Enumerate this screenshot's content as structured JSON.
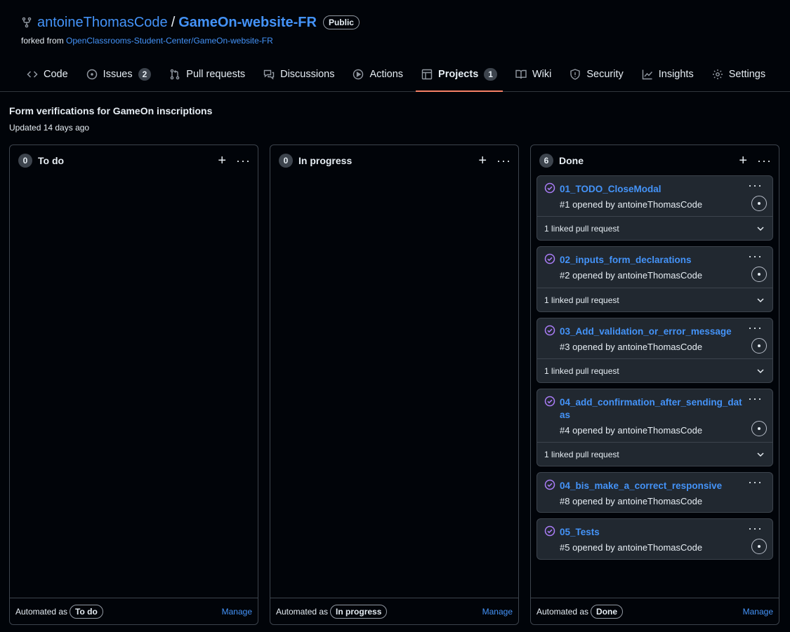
{
  "repo": {
    "owner": "antoineThomasCode",
    "slash": "/",
    "name": "GameOn-website-FR",
    "visibility": "Public",
    "forked_prefix": "forked from",
    "forked_from": "OpenClassrooms-Student-Center/GameOn-website-FR"
  },
  "tabs": [
    {
      "label": "Code",
      "icon": "code-icon"
    },
    {
      "label": "Issues",
      "icon": "issue-icon",
      "count": "2"
    },
    {
      "label": "Pull requests",
      "icon": "pull-request-icon"
    },
    {
      "label": "Discussions",
      "icon": "discussions-icon"
    },
    {
      "label": "Actions",
      "icon": "play-icon"
    },
    {
      "label": "Projects",
      "icon": "table-icon",
      "count": "1",
      "active": true
    },
    {
      "label": "Wiki",
      "icon": "book-icon"
    },
    {
      "label": "Security",
      "icon": "shield-icon"
    },
    {
      "label": "Insights",
      "icon": "graph-icon"
    },
    {
      "label": "Settings",
      "icon": "gear-icon"
    }
  ],
  "project": {
    "title": "Form verifications for GameOn inscriptions",
    "updated": "Updated 14 days ago"
  },
  "columns": [
    {
      "count": "0",
      "name": "To do",
      "automated_prefix": "Automated as",
      "automated_value": "To do",
      "manage": "Manage"
    },
    {
      "count": "0",
      "name": "In progress",
      "automated_prefix": "Automated as",
      "automated_value": "In progress",
      "manage": "Manage"
    },
    {
      "count": "6",
      "name": "Done",
      "automated_prefix": "Automated as",
      "automated_value": "Done",
      "manage": "Manage"
    }
  ],
  "cards": [
    {
      "title": "01_TODO_CloseModal",
      "sub": "#1 opened by antoineThomasCode",
      "linked": "1 linked pull request"
    },
    {
      "title": "02_inputs_form_declarations",
      "sub": "#2 opened by antoineThomasCode",
      "linked": "1 linked pull request"
    },
    {
      "title": "03_Add_validation_or_error_message",
      "sub": "#3 opened by antoineThomasCode",
      "linked": "1 linked pull request"
    },
    {
      "title": "04_add_confirmation_after_sending_datas",
      "sub": "#4 opened by antoineThomasCode",
      "linked": "1 linked pull request"
    },
    {
      "title": "04_bis_make_a_correct_responsive",
      "sub": "#8 opened by antoineThomasCode"
    },
    {
      "title": "05_Tests",
      "sub": "#5 opened by antoineThomasCode"
    }
  ],
  "colors": {
    "background": "#010409",
    "card_bg": "#212830",
    "link": "#4493f8",
    "active_tab_underline": "#f78166",
    "closed_issue": "#ab7df8"
  }
}
